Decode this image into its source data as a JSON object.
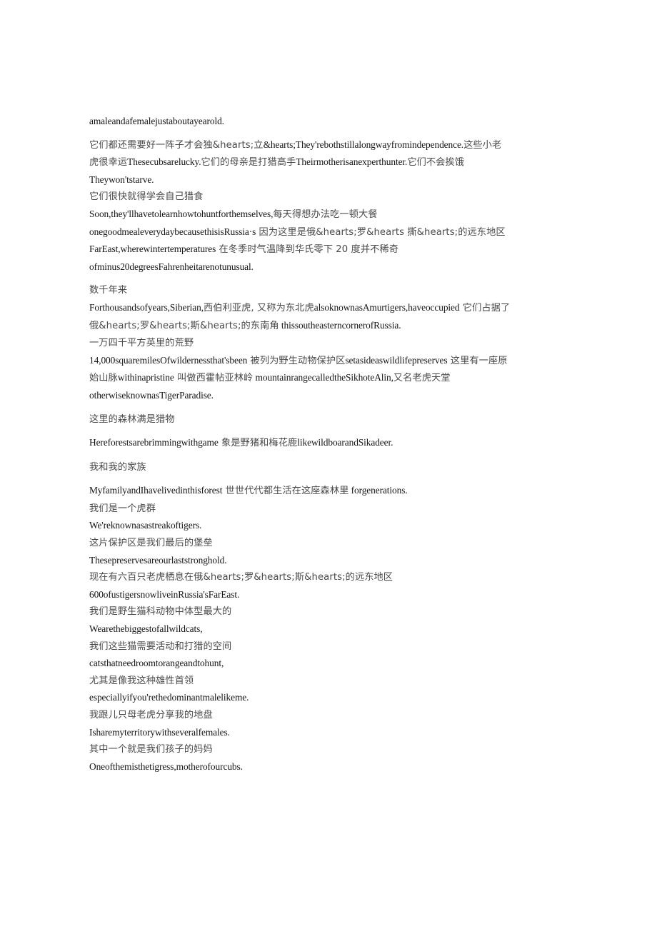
{
  "document": {
    "page_background": "#ffffff",
    "text_color_latin": "#141414",
    "text_color_cjk": "#4a4a4a",
    "paragraphs": [
      {
        "id": "p1",
        "runs": [
          {
            "lang": "en",
            "text": "amaleandafemalejustaboutayearold."
          }
        ]
      },
      {
        "id": "p2",
        "runs": [
          {
            "lang": "cn",
            "text": "它们都还需要好一阵子才会独&hearts;立"
          },
          {
            "lang": "en",
            "text": "&hearts;They'rebothstillalongwayfromindependence."
          },
          {
            "lang": "cn",
            "text": "这些小老虎很幸运"
          },
          {
            "lang": "en",
            "text": "Thesecubsarelucky."
          },
          {
            "lang": "cn",
            "text": "它们的母亲是打猎高手"
          },
          {
            "lang": "en",
            "text": "Theirmotherisanexperthunter."
          },
          {
            "lang": "cn",
            "text": "它们不会挨饿"
          }
        ]
      },
      {
        "id": "p3",
        "runs": [
          {
            "lang": "en",
            "text": "Theywon'tstarve."
          }
        ]
      },
      {
        "id": "p4",
        "runs": [
          {
            "lang": "cn",
            "text": "它们很快就得学会自己猎食"
          }
        ]
      },
      {
        "id": "p5",
        "runs": [
          {
            "lang": "en",
            "text": "Soon,they'llhavetolearnhowtohuntforthemselves,"
          },
          {
            "lang": "cn",
            "text": "每天得想办法吃一顿大餐"
          },
          {
            "lang": "en",
            "text": "onegoodmealeverydaybecausethisisRussia·s"
          },
          {
            "lang": "cn",
            "text": " 因为这里是俄&hearts;罗&hearts 撕&hearts;的远东地区"
          },
          {
            "lang": "en",
            "text": " FarEast,wherewintertemperatures"
          },
          {
            "lang": "cn",
            "text": " 在冬季时气温降到华氏零下 20 度并不稀奇"
          },
          {
            "lang": "en",
            "text": " ofminus20degreesFahrenheitarenotunusual."
          }
        ]
      },
      {
        "id": "p6",
        "runs": [
          {
            "lang": "cn",
            "text": "数千年来"
          }
        ]
      },
      {
        "id": "p7",
        "runs": [
          {
            "lang": "en",
            "text": "Forthousandsofyears,Siberian,"
          },
          {
            "lang": "cn",
            "text": "西伯利亚虎, 又称为东北虎"
          },
          {
            "lang": "en",
            "text": "alsoknownasAmurtigers,haveoccupied"
          },
          {
            "lang": "cn",
            "text": " 它们占据了俄&hearts;罗&hearts;斯&hearts;的东南角"
          },
          {
            "lang": "en",
            "text": " thissoutheasterncornerofRussia."
          }
        ]
      },
      {
        "id": "p8",
        "runs": [
          {
            "lang": "cn",
            "text": "一万四千平方英里的荒野"
          }
        ]
      },
      {
        "id": "p9",
        "runs": [
          {
            "lang": "en",
            "text": "14,000squaremilesOfwildernessthat'sbeen"
          },
          {
            "lang": "cn",
            "text": " 被列为野生动物保护区"
          },
          {
            "lang": "en",
            "text": "setasideaswildlifepreserves"
          },
          {
            "lang": "cn",
            "text": " 这里有一座原始山脉"
          },
          {
            "lang": "en",
            "text": "withinapristine"
          },
          {
            "lang": "cn",
            "text": " 叫做西霍帖亚林岭"
          },
          {
            "lang": "en",
            "text": " mountainrangecalledtheSikhoteAlin,"
          },
          {
            "lang": "cn",
            "text": "又名老虎天堂"
          },
          {
            "lang": "en",
            "text": "otherwiseknownasTigerParadise."
          }
        ]
      },
      {
        "id": "p10",
        "runs": [
          {
            "lang": "cn",
            "text": "这里的森林满是猎物"
          }
        ]
      },
      {
        "id": "p11",
        "runs": [
          {
            "lang": "en",
            "text": "Hereforestsarebrimmingwithgame"
          },
          {
            "lang": "cn",
            "text": " 象是野猪和梅花鹿"
          },
          {
            "lang": "en",
            "text": "likewildboarandSikadeer."
          }
        ]
      },
      {
        "id": "p12",
        "runs": [
          {
            "lang": "cn",
            "text": "我和我的家族"
          }
        ]
      },
      {
        "id": "p13",
        "runs": [
          {
            "lang": "en",
            "text": "MyfamilyandIhavelivedinthisforest"
          },
          {
            "lang": "cn",
            "text": " 世世代代都生活在这座森林里"
          },
          {
            "lang": "en",
            "text": " forgenerations."
          }
        ]
      },
      {
        "id": "p14",
        "runs": [
          {
            "lang": "cn",
            "text": "我们是一个虎群"
          }
        ]
      },
      {
        "id": "p15",
        "runs": [
          {
            "lang": "en",
            "text": "We'reknownasastreakoftigers."
          }
        ]
      },
      {
        "id": "p16",
        "runs": [
          {
            "lang": "cn",
            "text": "这片保护区是我们最后的堡垒"
          }
        ]
      },
      {
        "id": "p17",
        "runs": [
          {
            "lang": "en",
            "text": "Thesepreservesareourlaststronghold."
          }
        ]
      },
      {
        "id": "p18",
        "runs": [
          {
            "lang": "cn",
            "text": "现在有六百只老虎栖息在俄&hearts;罗&hearts;斯&hearts;的远东地区"
          }
        ]
      },
      {
        "id": "p19",
        "runs": [
          {
            "lang": "en",
            "text": "600ofustigersnowliveinRussia'sFarEast."
          }
        ]
      },
      {
        "id": "p20",
        "runs": [
          {
            "lang": "cn",
            "text": "我们是野生猫科动物中体型最大的"
          }
        ]
      },
      {
        "id": "p21",
        "runs": [
          {
            "lang": "en",
            "text": "Wearethebiggestofallwildcats,"
          }
        ]
      },
      {
        "id": "p22",
        "runs": [
          {
            "lang": "cn",
            "text": "我们这些猫需要活动和打猎的空间"
          }
        ]
      },
      {
        "id": "p23",
        "runs": [
          {
            "lang": "en",
            "text": "catsthatneedroomtorangeandtohunt,"
          }
        ]
      },
      {
        "id": "p24",
        "runs": [
          {
            "lang": "cn",
            "text": "尤其是像我这种雄性首领"
          }
        ]
      },
      {
        "id": "p25",
        "runs": [
          {
            "lang": "en",
            "text": "especiallyifyou'rethedominantmalelikeme."
          }
        ]
      },
      {
        "id": "p26",
        "runs": [
          {
            "lang": "cn",
            "text": "我跟儿只母老虎分享我的地盘"
          }
        ]
      },
      {
        "id": "p27",
        "runs": [
          {
            "lang": "en",
            "text": "Isharemyterritorywithseveralfemales."
          }
        ]
      },
      {
        "id": "p28",
        "runs": [
          {
            "lang": "cn",
            "text": "其中一个就是我们孩子的妈妈"
          }
        ]
      },
      {
        "id": "p29",
        "runs": [
          {
            "lang": "en",
            "text": "Oneofthemisthetigress,motherofourcubs."
          }
        ]
      }
    ]
  }
}
